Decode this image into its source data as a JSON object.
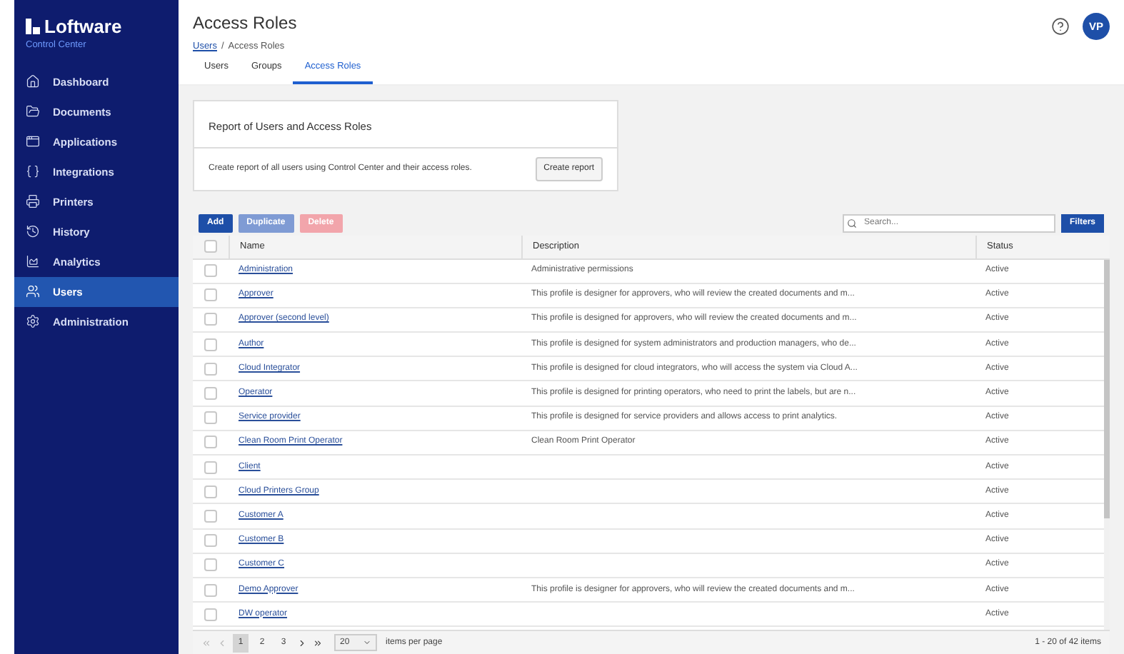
{
  "sidebar": {
    "logo": "Loftware",
    "subtitle": "Control Center",
    "items": [
      {
        "label": "Dashboard",
        "selected": false
      },
      {
        "label": "Documents",
        "selected": false
      },
      {
        "label": "Applications",
        "selected": false
      },
      {
        "label": "Integrations",
        "selected": false
      },
      {
        "label": "Printers",
        "selected": false
      },
      {
        "label": "History",
        "selected": false
      },
      {
        "label": "Analytics",
        "selected": false
      },
      {
        "label": "Users",
        "selected": true
      },
      {
        "label": "Administration",
        "selected": false
      }
    ]
  },
  "header": {
    "title": "Access Roles",
    "breadcrumb": {
      "link": "Users",
      "separator": "/",
      "current": "Access Roles"
    },
    "avatar": "VP"
  },
  "tabs": [
    {
      "label": "Users",
      "selected": false
    },
    {
      "label": "Groups",
      "selected": false
    },
    {
      "label": "Access Roles",
      "selected": true
    }
  ],
  "report": {
    "title": "Report of Users and Access Roles",
    "text": "Create report of all users using Control Center and their access roles.",
    "button": "Create report"
  },
  "toolbar": {
    "buttons": [
      {
        "label": "Add",
        "kind": "primary",
        "disabled": false
      },
      {
        "label": "Duplicate",
        "kind": "primary",
        "disabled": true
      },
      {
        "label": "Delete",
        "kind": "danger",
        "disabled": true
      }
    ],
    "search": {
      "placeholder": "Search..."
    },
    "filters": "Filters"
  },
  "table": {
    "columns": [
      "Name",
      "Description",
      "Status"
    ],
    "all_checked": false,
    "rows": [
      {
        "name": "Administration",
        "description": "Administrative permissions",
        "status": "Active",
        "checked": false
      },
      {
        "name": "Approver",
        "description": "This profile is designer for approvers, who will review the created documents and m...",
        "status": "Active",
        "checked": false
      },
      {
        "name": "Approver (second level)",
        "description": "This profile is designed for approvers, who will review the created documents and m...",
        "status": "Active",
        "checked": false
      },
      {
        "name": "Author",
        "description": "This profile is designed for system administrators and production managers, who de...",
        "status": "Active",
        "checked": false
      },
      {
        "name": "Cloud Integrator",
        "description": "This profile is designed for cloud integrators, who will access the system via Cloud A...",
        "status": "Active",
        "checked": false
      },
      {
        "name": "Operator",
        "description": "This profile is designed for printing operators, who need to print the labels, but are n...",
        "status": "Active",
        "checked": false
      },
      {
        "name": "Service provider",
        "description": "This profile is designed for service providers and allows access to print analytics.",
        "status": "Active",
        "checked": false
      },
      {
        "name": "Clean Room Print Operator",
        "description": "Clean Room Print Operator",
        "status": "Active",
        "checked": false
      },
      {
        "name": "Client",
        "status": "Active",
        "checked": false
      },
      {
        "name": "Cloud Printers Group",
        "status": "Active",
        "checked": false
      },
      {
        "name": "Customer A",
        "status": "Active",
        "checked": false
      },
      {
        "name": "Customer B",
        "status": "Active",
        "checked": false
      },
      {
        "name": "Customer C",
        "status": "Active",
        "checked": false
      },
      {
        "name": "Demo Approver",
        "description": "This profile is designer for approvers, who will review the created documents and m...",
        "status": "Active",
        "checked": false
      },
      {
        "name": "DW operator",
        "status": "Active",
        "checked": false
      }
    ]
  },
  "pagination": {
    "pages": [
      {
        "label": "1",
        "selected": true
      },
      {
        "label": "2",
        "selected": false
      },
      {
        "label": "3",
        "selected": false
      }
    ],
    "per_page": "20",
    "per_page_label": "items per page",
    "summary": "1 - 20 of 42 items"
  }
}
